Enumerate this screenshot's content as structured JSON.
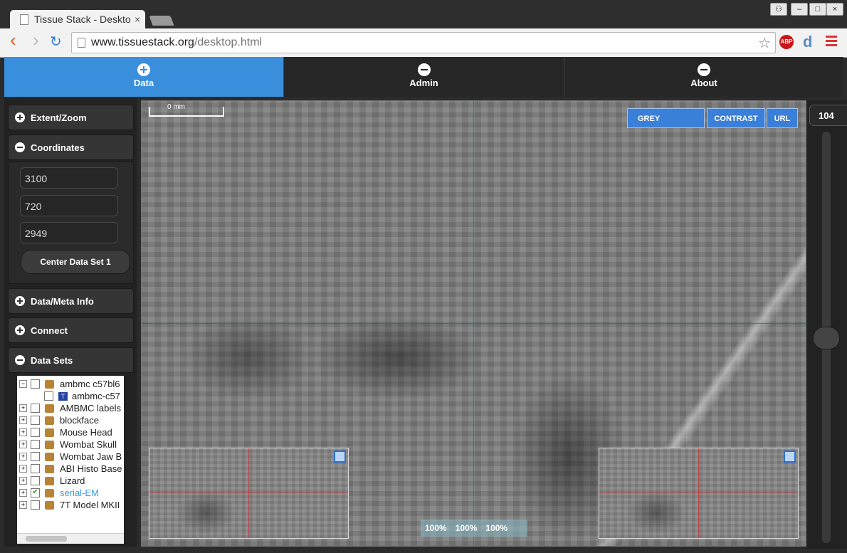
{
  "browser": {
    "tab_title": "Tissue Stack - Desktop",
    "tab_close": "×",
    "url_host": "www.tissuestack.org",
    "url_path": "/desktop.html",
    "back": "‹",
    "forward": "›",
    "reload": "↻",
    "star": "☆",
    "abp": "ABP",
    "ext_d": "d",
    "win_user": "⚇",
    "win_min": "–",
    "win_max": "□",
    "win_close": "×"
  },
  "nav": {
    "tabs": [
      {
        "label": "Data",
        "active": true
      },
      {
        "label": "Admin",
        "active": false
      },
      {
        "label": "About",
        "active": false
      }
    ]
  },
  "sidebar": {
    "extent_zoom": "Extent/Zoom",
    "coordinates": "Coordinates",
    "coord_x": "3100",
    "coord_y": "720",
    "coord_z": "2949",
    "center_button": "Center Data Set 1",
    "data_meta": "Data/Meta Info",
    "connect": "Connect",
    "data_sets": "Data Sets"
  },
  "tree": {
    "items": [
      {
        "label": "ambmc c57bl6",
        "expander": "−",
        "checked": false,
        "type": "folder"
      },
      {
        "label": "ambmc-c57",
        "expander": "",
        "checked": false,
        "type": "doc"
      },
      {
        "label": "AMBMC labels",
        "expander": "+",
        "checked": false,
        "type": "folder"
      },
      {
        "label": "blockface",
        "expander": "+",
        "checked": false,
        "type": "folder"
      },
      {
        "label": "Mouse Head",
        "expander": "+",
        "checked": false,
        "type": "folder"
      },
      {
        "label": "Wombat Skull",
        "expander": "+",
        "checked": false,
        "type": "folder"
      },
      {
        "label": "Wombat Jaw B",
        "expander": "+",
        "checked": false,
        "type": "folder"
      },
      {
        "label": "ABI Histo Base",
        "expander": "+",
        "checked": false,
        "type": "folder"
      },
      {
        "label": "Lizard",
        "expander": "+",
        "checked": false,
        "type": "folder"
      },
      {
        "label": "serial-EM",
        "expander": "+",
        "checked": true,
        "type": "folder"
      },
      {
        "label": "7T Model MKII",
        "expander": "+",
        "checked": false,
        "type": "folder"
      }
    ]
  },
  "viewer": {
    "scale_label": "0 mm",
    "grey": "GREY",
    "contrast": "CONTRAST",
    "url": "URL",
    "zoom_values": [
      "100%",
      "100%",
      "100%"
    ],
    "slice_value": "104"
  },
  "colors": {
    "accent": "#3a8fdc",
    "selected_dataset": "#3a9fdc",
    "crosshair": "#c82828"
  }
}
